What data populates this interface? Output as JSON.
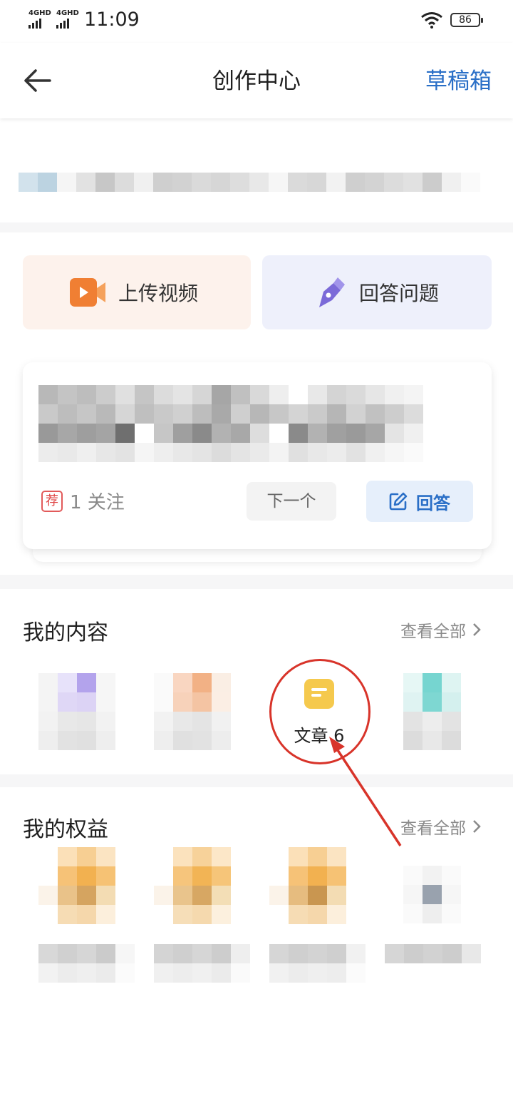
{
  "status_bar": {
    "signal1": "4GHD",
    "signal2": "4GHD",
    "time": "11:09",
    "battery": "86"
  },
  "nav": {
    "title": "创作中心",
    "drafts": "草稿箱"
  },
  "quick_actions": {
    "upload_video": "上传视频",
    "answer_question": "回答问题"
  },
  "question_card": {
    "badge": "荐",
    "follow_count": "1 关注",
    "next_button": "下一个",
    "answer_button": "回答"
  },
  "my_content": {
    "title": "我的内容",
    "view_all": "查看全部",
    "article_label": "文章 6"
  },
  "my_benefits": {
    "title": "我的权益",
    "view_all": "查看全部"
  },
  "colors": {
    "accent_blue": "#2a6fc7",
    "annotation_red": "#d8342a",
    "article_icon": "#f5c94d"
  }
}
